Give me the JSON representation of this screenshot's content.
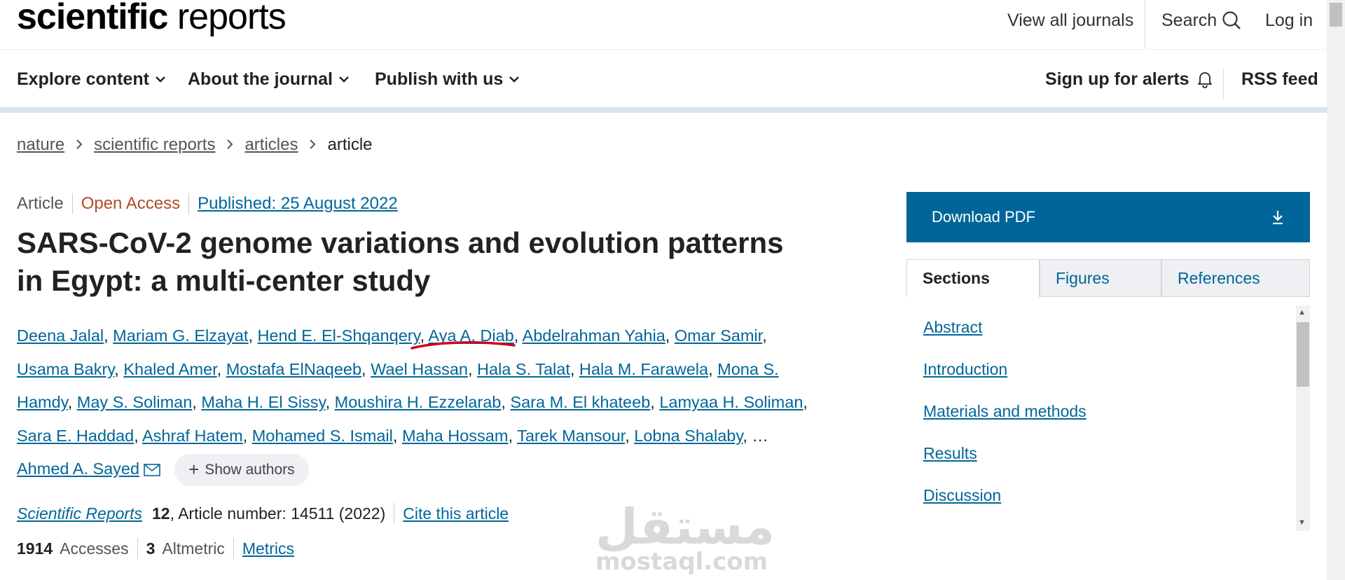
{
  "header": {
    "logo_bold": "scientific",
    "logo_light": " reports",
    "view_all": "View all journals",
    "search": "Search",
    "login": "Log in",
    "search_icon": "search-icon"
  },
  "nav": {
    "items": [
      "Explore content",
      "About the journal",
      "Publish with us"
    ],
    "alerts": "Sign up for alerts",
    "rss": "RSS feed",
    "alert_icon": "bell-icon"
  },
  "breadcrumb": [
    "nature",
    "scientific reports",
    "articles",
    "article"
  ],
  "meta": {
    "type": "Article",
    "access": "Open Access",
    "published": "Published: 25 August 2022"
  },
  "title": "SARS-CoV-2 genome variations and evolution patterns in Egypt: a multi-center study",
  "authors": [
    "Deena Jalal",
    "Mariam G. Elzayat",
    "Hend E. El-Shqanqery",
    "Aya A. Diab",
    "Abdelrahman Yahia",
    "Omar Samir",
    "Usama Bakry",
    "Khaled Amer",
    "Mostafa ElNaqeeb",
    "Wael Hassan",
    "Hala S. Talat",
    "Hala M. Farawela",
    "Mona S. Hamdy",
    "May S. Soliman",
    "Maha H. El Sissy",
    "Moushira H. Ezzelarab",
    "Sara M. El khateeb",
    "Lamyaa H. Soliman",
    "Sara E. Haddad",
    "Ashraf Hatem",
    "Mohamed S. Ismail",
    "Maha Hossam",
    "Tarek Mansour",
    "Lobna Shalaby"
  ],
  "ellipsis": "…",
  "last_author": "Ahmed A. Sayed",
  "show_authors": "Show authors",
  "journal": {
    "name": "Scientific Reports",
    "volume": "12",
    "article_number": ", Article number: 14511 (2022)",
    "cite": "Cite this article"
  },
  "metrics": {
    "accesses_count": "1914",
    "accesses_label": "Accesses",
    "altmetric_count": "3",
    "altmetric_label": "Altmetric",
    "metrics_link": "Metrics"
  },
  "watermark": {
    "arabic": "مستقل",
    "latin": "mostaql.com"
  },
  "sidebar": {
    "download": "Download PDF",
    "tabs": [
      "Sections",
      "Figures",
      "References"
    ],
    "sections": [
      "Abstract",
      "Introduction",
      "Materials and methods",
      "Results",
      "Discussion"
    ]
  },
  "colors": {
    "link": "#006699",
    "open_access": "#b54a25",
    "download_bg": "#006699",
    "annotation": "#d0021b"
  }
}
